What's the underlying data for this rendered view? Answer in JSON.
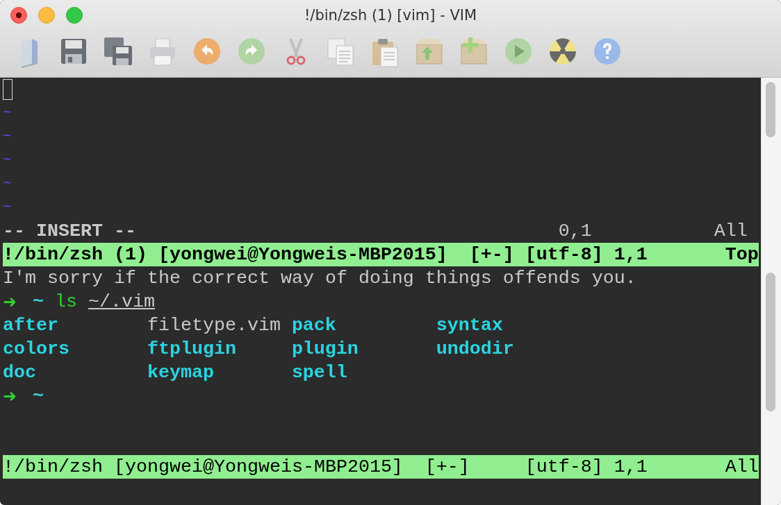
{
  "window": {
    "title": "!/bin/zsh (1) [vim] - VIM"
  },
  "top_pane": {
    "lines": [
      {
        "kind": "cursor"
      },
      {
        "kind": "tilde",
        "text": "~"
      },
      {
        "kind": "tilde",
        "text": "~"
      },
      {
        "kind": "tilde",
        "text": "~"
      },
      {
        "kind": "tilde",
        "text": "~"
      },
      {
        "kind": "tilde",
        "text": "~"
      }
    ],
    "mode": "-- INSERT --",
    "ruler": "0,1",
    "ruler_scroll": "All",
    "status": {
      "name": "!/bin/zsh (1) [yongwei@Yongweis-MBP2015]",
      "flags": "[+-]",
      "encoding": "[utf-8] 1,1",
      "scroll": "Top",
      "current": true
    }
  },
  "bottom_pane": {
    "lines": [
      {
        "kind": "output",
        "text": "I'm sorry if the correct way of doing things offends you."
      },
      {
        "kind": "prompt",
        "arrow": "➜",
        "cwd": "~",
        "command": "ls",
        "argument": "~/.vim"
      },
      {
        "kind": "listing",
        "entries": [
          {
            "text": "after",
            "kind": "dir"
          },
          {
            "text": "filetype.vim",
            "kind": "file"
          },
          {
            "text": "pack",
            "kind": "dir"
          },
          {
            "text": "syntax",
            "kind": "dir"
          }
        ]
      },
      {
        "kind": "listing",
        "entries": [
          {
            "text": "colors",
            "kind": "dir"
          },
          {
            "text": "ftplugin",
            "kind": "dir"
          },
          {
            "text": "plugin",
            "kind": "dir"
          },
          {
            "text": "undodir",
            "kind": "dir"
          }
        ]
      },
      {
        "kind": "listing",
        "entries": [
          {
            "text": "doc",
            "kind": "dir"
          },
          {
            "text": "keymap",
            "kind": "dir"
          },
          {
            "text": "spell",
            "kind": "dir"
          }
        ]
      },
      {
        "kind": "prompt",
        "arrow": "➜",
        "cwd": "~"
      }
    ],
    "status": {
      "name": "!/bin/zsh [yongwei@Yongweis-MBP2015]",
      "flags": "[+-]",
      "encoding": "[utf-8] 1,1",
      "scroll": "All",
      "current": false
    }
  }
}
